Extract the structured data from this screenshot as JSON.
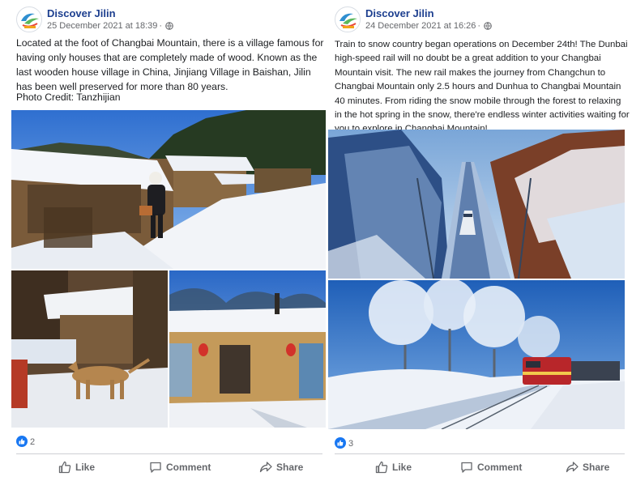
{
  "posts": [
    {
      "page_name": "Discover Jilin",
      "timestamp": "25 December 2021 at 18:39",
      "audience_icon": "globe-icon",
      "text": "Located at the foot of Changbai Mountain, there is a village famous for having only houses that are completely made of wood. Known as the last wooden house village in China, Jinjiang Village in Baishan, Jilin has been well preserved for more than 80 years.",
      "credit": "Photo Credit: Tanzhijian",
      "reaction_count": "2",
      "actions": {
        "like": "Like",
        "comment": "Comment",
        "share": "Share"
      }
    },
    {
      "page_name": "Discover Jilin",
      "timestamp": "24 December 2021 at 16:26",
      "audience_icon": "globe-icon",
      "text": "Train to snow country began operations on December 24th! The Dunbai high-speed rail will no doubt be a great addition to your Changbai Mountain visit. The new rail makes the journey from Changchun to Changbai Mountain only 2.5 hours and Dunhua to Changbai Mountain 40 minutes. From riding the snow mobile through the forest to relaxing in the hot spring in the snow, there're endless winter activities waiting for you to explore in Changbai Mountain!",
      "reaction_count": "3",
      "actions": {
        "like": "Like",
        "comment": "Comment",
        "share": "Share"
      }
    }
  ],
  "colors": {
    "brand": "#1d3f8f",
    "like_blue": "#1877f2",
    "muted": "#65676b"
  }
}
